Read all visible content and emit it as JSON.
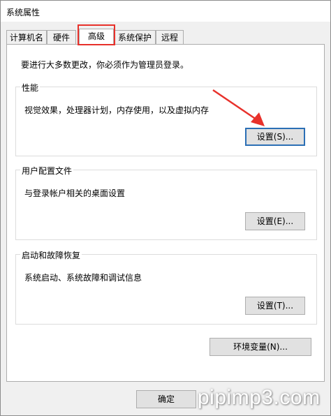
{
  "window": {
    "title": "系统属性"
  },
  "tabs": [
    {
      "label": "计算机名"
    },
    {
      "label": "硬件"
    },
    {
      "label": "高级"
    },
    {
      "label": "系统保护"
    },
    {
      "label": "远程"
    }
  ],
  "active_tab": "高级",
  "advanced": {
    "admin_note": "要进行大多数更改，你必须作为管理员登录。",
    "performance": {
      "title": "性能",
      "description": "视觉效果，处理器计划，内存使用，以及虚拟内存",
      "button": "设置(S)..."
    },
    "user_profiles": {
      "title": "用户配置文件",
      "description": "与登录帐户相关的桌面设置",
      "button": "设置(E)..."
    },
    "startup_recovery": {
      "title": "启动和故障恢复",
      "description": "系统启动、系统故障和调试信息",
      "button": "设置(T)..."
    },
    "env_button": "环境变量(N)..."
  },
  "footer": {
    "ok_button": "确定"
  },
  "watermark": "pipimp3.com",
  "colors": {
    "highlight_red": "#e8312b",
    "focus_blue": "#2b6fb5"
  }
}
